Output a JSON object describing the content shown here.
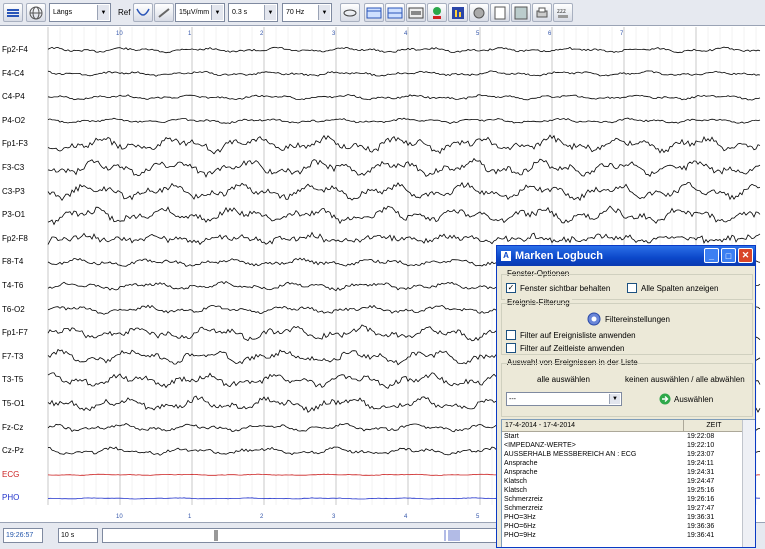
{
  "toolbar": {
    "montage_select": "Längs",
    "ref_label": "Ref",
    "sensitivity": "15µV/mm",
    "time_constant": "0.3 s",
    "filter": "70 Hz",
    "icons": [
      "menu-icon",
      "globe-icon",
      "filter-wave-icon",
      "link-icon",
      "eye-icon",
      "layout1-icon",
      "layout2-icon",
      "layout3-icon",
      "green-ball-icon",
      "chart-icon",
      "photo-icon",
      "notes-icon",
      "print-icon",
      "sleep-icon"
    ]
  },
  "channels": [
    "Fp2-F4",
    "F4-C4",
    "C4-P4",
    "P4-O2",
    "Fp1-F3",
    "F3-C3",
    "C3-P3",
    "P3-O1",
    "Fp2-F8",
    "F8-T4",
    "T4-T6",
    "T6-O2",
    "Fp1-F7",
    "F7-T3",
    "T3-T5",
    "T5-O1",
    "Fz-Cz",
    "Cz-Pz",
    "ECG",
    "PHO"
  ],
  "time_ticks_top": [
    "10",
    "1",
    "2",
    "3",
    "4",
    "5",
    "6",
    "7"
  ],
  "bottom": {
    "time": "19:26:57",
    "window": "10 s"
  },
  "dialog": {
    "title": "Marken Logbuch",
    "fenster_group": "Fenster-Optionen",
    "keep_visible": "Fenster sichtbar behalten",
    "all_columns": "Alle Spalten anzeigen",
    "event_filter_group": "Ereignis-Filterung",
    "filter_settings": "Filtereinstellungen",
    "filter_eventlist": "Filter auf Ereignisliste anwenden",
    "filter_timeline": "Filter auf Zeitleiste anwenden",
    "selection_group": "Auswahl von Ereignissen in der Liste",
    "select_all": "alle auswählen",
    "select_none": "keinen auswählen / alle abwählen",
    "combo_value": "---",
    "select_button": "Auswählen",
    "list": {
      "col_event": "17-4-2014 - 17-4-2014",
      "col_time": "ZEIT",
      "rows": [
        {
          "event": "Start",
          "time": "19:22:08"
        },
        {
          "event": "<IMPEDANZ-WERTE>",
          "time": "19:22:10"
        },
        {
          "event": "AUSSERHALB MESSBEREICH AN : ECG",
          "time": "19:23:07"
        },
        {
          "event": "Ansprache",
          "time": "19:24:11"
        },
        {
          "event": "Ansprache",
          "time": "19:24:31"
        },
        {
          "event": "Klatsch",
          "time": "19:24:47"
        },
        {
          "event": "Klatsch",
          "time": "19:25:16"
        },
        {
          "event": "Schmerzreiz",
          "time": "19:26:16"
        },
        {
          "event": "Schmerzreiz",
          "time": "19:27:47"
        },
        {
          "event": "PHO=3Hz",
          "time": "19:36:31"
        },
        {
          "event": "PHO=6Hz",
          "time": "19:36:36"
        },
        {
          "event": "PHO=9Hz",
          "time": "19:36:41"
        }
      ]
    }
  },
  "colors": {
    "ecg": "#cc2222",
    "pho": "#2233cc",
    "trace": "#000000",
    "grid": "#c8c8c8",
    "accent": "#0b47c9"
  }
}
